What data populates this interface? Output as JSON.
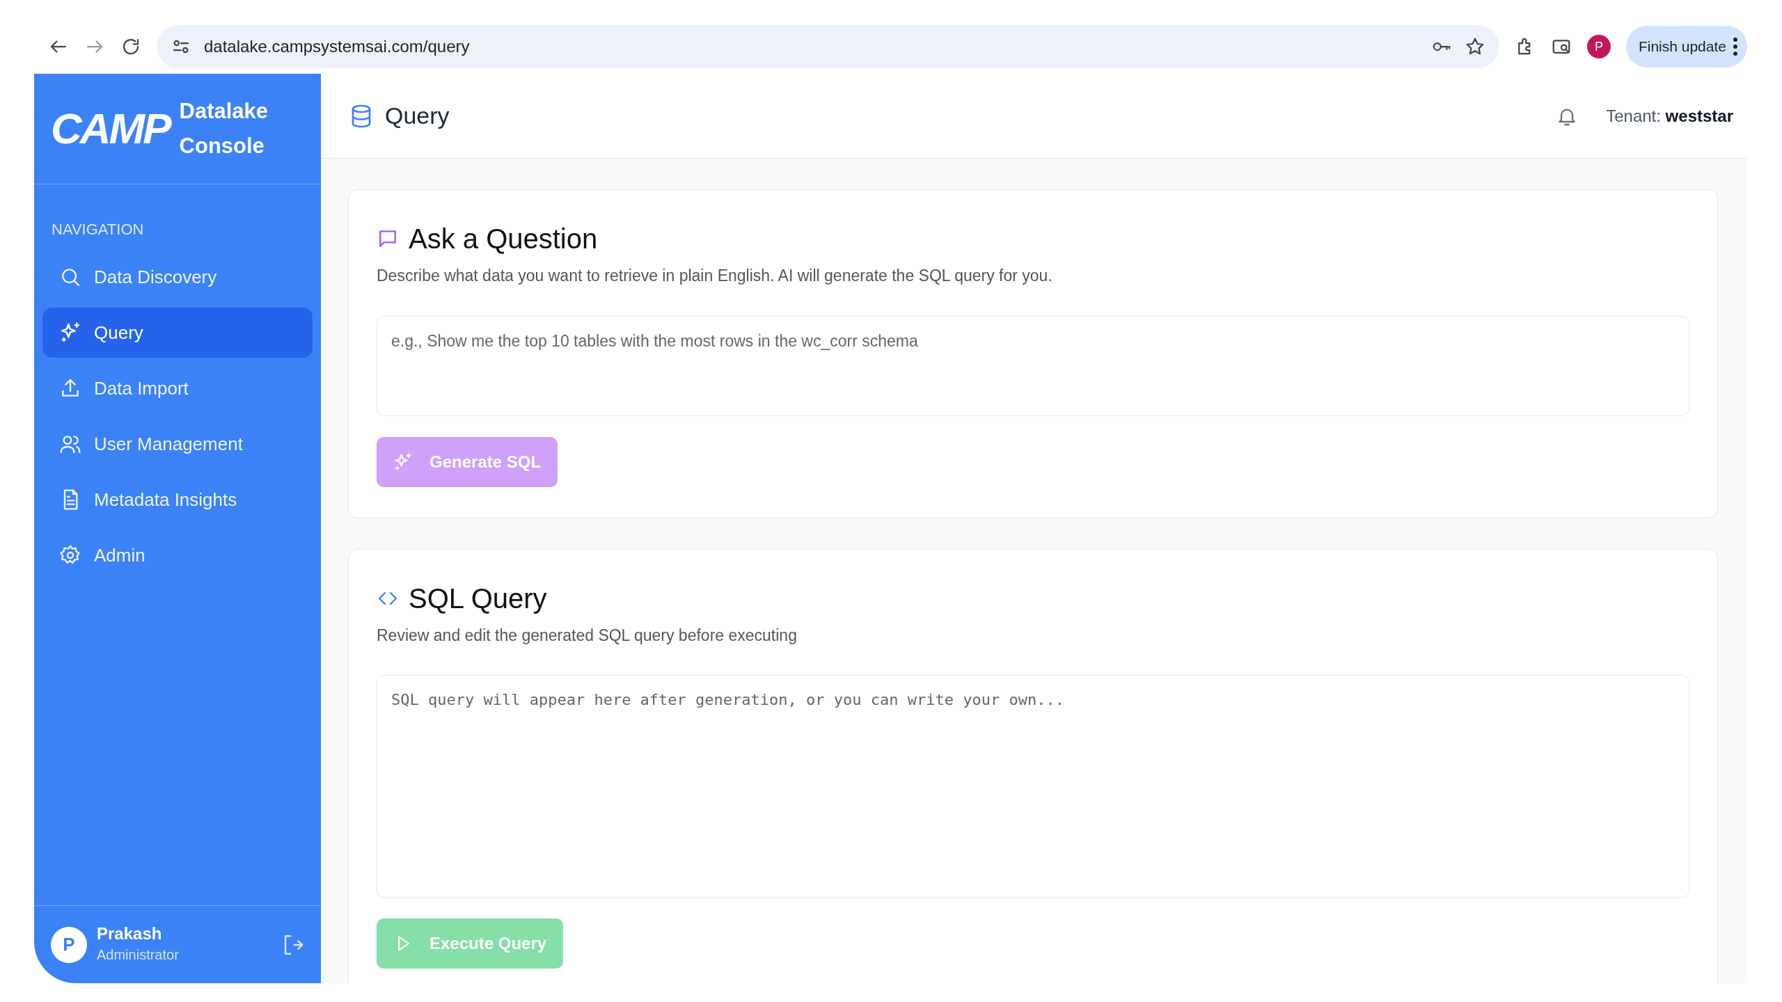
{
  "browser": {
    "url": "datalake.campsystemsai.com/query",
    "profile_initial": "P",
    "update_button": "Finish update"
  },
  "sidebar": {
    "logo": "CAMP",
    "app_name": "Datalake Console",
    "section_label": "NAVIGATION",
    "items": [
      {
        "label": "Data Discovery",
        "selected": false
      },
      {
        "label": "Query",
        "selected": true
      },
      {
        "label": "Data Import",
        "selected": false
      },
      {
        "label": "User Management",
        "selected": false
      },
      {
        "label": "Metadata Insights",
        "selected": false
      },
      {
        "label": "Admin",
        "selected": false
      }
    ],
    "user": {
      "initial": "P",
      "name": "Prakash",
      "role": "Administrator"
    }
  },
  "header": {
    "title": "Query",
    "tenant_label": "Tenant:",
    "tenant": "weststar"
  },
  "cards": [
    {
      "title": "Ask a Question",
      "description": "Describe what data you want to retrieve in plain English. AI will generate the SQL query for you.",
      "field": {
        "kind": "text",
        "placeholder": "e.g., Show me the top 10 tables with the most rows in the wc_corr schema"
      },
      "button": {
        "label": "Generate SQL",
        "kind": "purple",
        "disabled": true
      }
    },
    {
      "title": "SQL Query",
      "description": "Review and edit the generated SQL query before executing",
      "field": {
        "kind": "code",
        "placeholder": "SQL query will appear here after generation, or you can write your own..."
      },
      "button": {
        "label": "Execute Query",
        "kind": "green",
        "disabled": true
      }
    }
  ]
}
